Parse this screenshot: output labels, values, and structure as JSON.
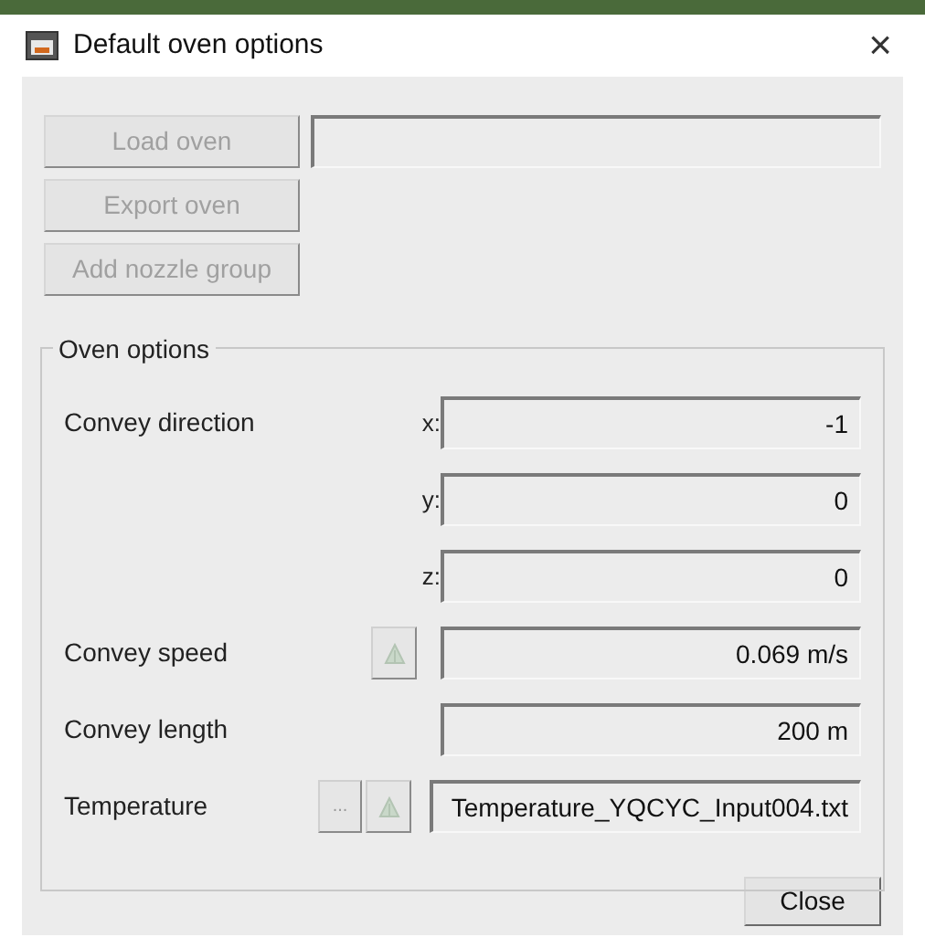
{
  "window": {
    "title": "Default oven options",
    "close": "×"
  },
  "actions": [
    {
      "label": "Load oven",
      "disabled": true
    },
    {
      "label": "Export oven",
      "disabled": true
    },
    {
      "label": "Add nozzle group",
      "disabled": true
    }
  ],
  "oven_options": {
    "title": "Oven options",
    "rows": [
      {
        "kind": "vector",
        "label": "Convey direction",
        "components": [
          {
            "axis": "x:",
            "value": "-1"
          },
          {
            "axis": "y:",
            "value": "0"
          },
          {
            "axis": "z:",
            "value": "0"
          }
        ]
      },
      {
        "kind": "picked",
        "label": "Convey speed",
        "value": "0.069 m/s"
      },
      {
        "kind": "plain",
        "label": "Convey length",
        "value": "200 m"
      },
      {
        "kind": "file",
        "label": "Temperature",
        "browse": "...",
        "value": "Temperature_YQCYC_Input004.txt"
      }
    ]
  },
  "buttons": [
    "Close"
  ]
}
